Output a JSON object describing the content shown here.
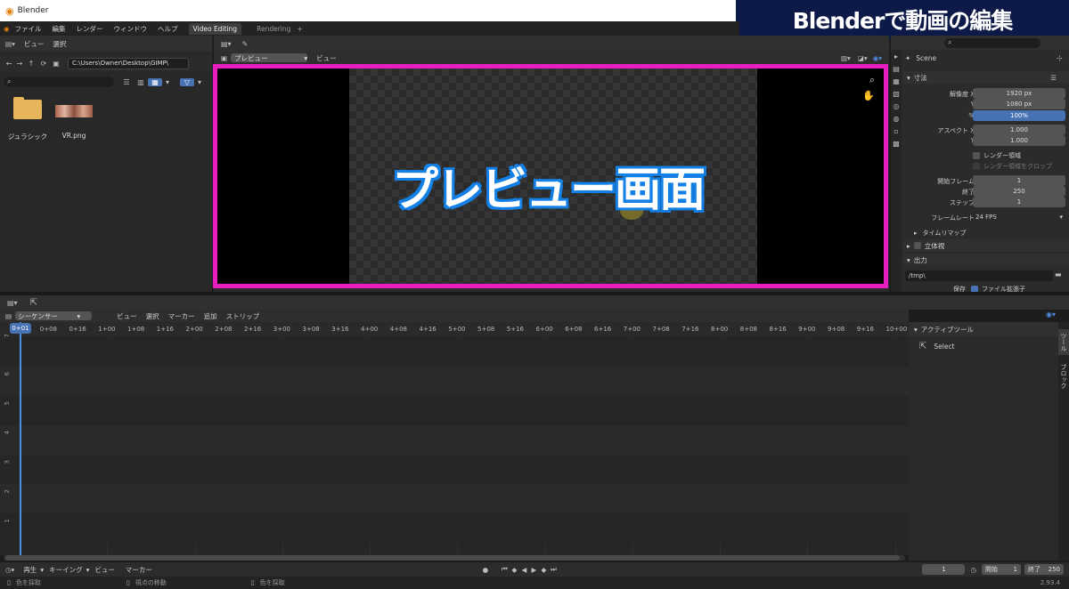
{
  "window": {
    "title": "Blender",
    "version": "2.93.4"
  },
  "banner": {
    "text": "Blenderで動画の編集"
  },
  "menu": {
    "items": [
      "ファイル",
      "編集",
      "レンダー",
      "ウィンドウ",
      "ヘルプ"
    ],
    "tabs": [
      {
        "label": "Video Editing",
        "active": true
      },
      {
        "label": "Rendering",
        "active": false
      }
    ],
    "add_tab": "+"
  },
  "file_browser": {
    "menu": [
      "ビュー",
      "選択"
    ],
    "path": "C:\\Users\\Owner\\Desktop\\GIMP\\",
    "files": [
      {
        "name": "ジュラシック",
        "type": "folder"
      },
      {
        "name": "VR.png",
        "type": "image"
      }
    ]
  },
  "preview": {
    "mode_select": "プレビュー",
    "view_menu": "ビュー",
    "caption": "プレビュー画面",
    "highlight_color": "#e81fbe",
    "caption_color": "#1380e6"
  },
  "properties": {
    "scene": "Scene",
    "dimensions_section": "寸法",
    "resolution_x_label": "解像度 X",
    "resolution_x": "1920 px",
    "resolution_y_label": "Y",
    "resolution_y": "1080 px",
    "percent_label": "%",
    "percent": "100%",
    "aspect_x_label": "アスペクト X",
    "aspect_x": "1.000",
    "aspect_y_label": "Y",
    "aspect_y": "1.000",
    "render_region": "レンダー領域",
    "crop_region": "レンダー領域をクロップ",
    "frame_start_label": "開始フレーム",
    "frame_start": "1",
    "frame_end_label": "終了",
    "frame_end": "250",
    "frame_step_label": "ステップ",
    "frame_step": "1",
    "frame_rate_label": "フレームレート",
    "frame_rate": "24 FPS",
    "time_remap": "タイムリマップ",
    "stereoscopy": "立体視",
    "output_section": "出力",
    "output_path": "/tmp\\",
    "save_label": "保存",
    "file_ext": "ファイル拡張子"
  },
  "sequencer": {
    "mode_select": "シーケンサー",
    "menu": [
      "ビュー",
      "選択",
      "マーカー",
      "追加",
      "ストリップ"
    ],
    "ruler": [
      "0+01",
      "0+08",
      "0+16",
      "1+00",
      "1+08",
      "1+16",
      "2+00",
      "2+08",
      "2+16",
      "3+00",
      "3+08",
      "3+16",
      "4+00",
      "4+08",
      "4+16",
      "5+00",
      "5+08",
      "5+16",
      "6+00",
      "6+08",
      "6+16",
      "7+00",
      "7+08",
      "7+16",
      "8+00",
      "8+08",
      "8+16",
      "9+00",
      "9+08",
      "9+16",
      "10+00"
    ],
    "channels": [
      "7",
      "6",
      "5",
      "4",
      "3",
      "2",
      "1"
    ],
    "active_tool_header": "アクティブツール",
    "active_tool": "Select",
    "side_tabs": [
      "ツール",
      "ブロック"
    ]
  },
  "timeline_footer": {
    "menu": [
      "再生",
      "キーイング",
      "ビュー",
      "マーカー"
    ],
    "current_frame": "1",
    "start_label": "開始",
    "start": "1",
    "end_label": "終了",
    "end": "250"
  },
  "status_bar": {
    "items": [
      "色を採取",
      "視点の移動",
      "色を採取"
    ]
  }
}
